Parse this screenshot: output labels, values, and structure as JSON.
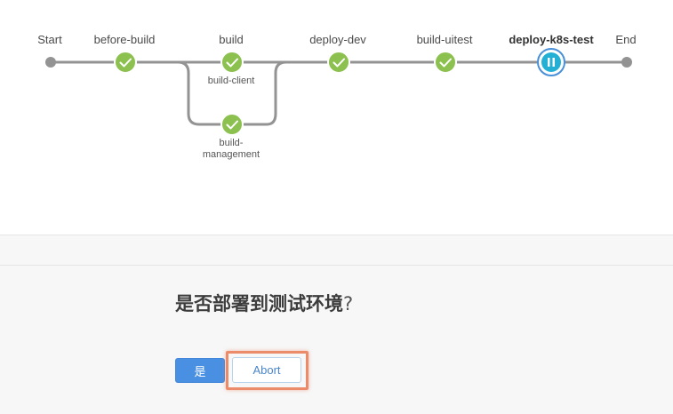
{
  "pipeline": {
    "stages": [
      {
        "label": "Start",
        "status": "boundary"
      },
      {
        "label": "before-build",
        "status": "success"
      },
      {
        "label": "build",
        "status": "success"
      },
      {
        "label": "deploy-dev",
        "status": "success"
      },
      {
        "label": "build-uitest",
        "status": "success"
      },
      {
        "label": "deploy-k8s-test",
        "status": "paused"
      },
      {
        "label": "End",
        "status": "boundary"
      }
    ],
    "parallel_branches": [
      {
        "label": "build-client",
        "status": "success"
      },
      {
        "label": "build-\nmanagement",
        "status": "success"
      }
    ],
    "colors": {
      "success": "#8cc04f",
      "paused_ring": "#4a90d9",
      "paused_fill": "#24b0d5",
      "edge": "#949393",
      "boundary": "#949393"
    },
    "icons": {
      "success": "check-icon",
      "paused": "pause-icon"
    }
  },
  "input": {
    "question": "是否部署到测试环境",
    "question_mark": "?",
    "proceed_label": "是",
    "abort_label": "Abort"
  }
}
